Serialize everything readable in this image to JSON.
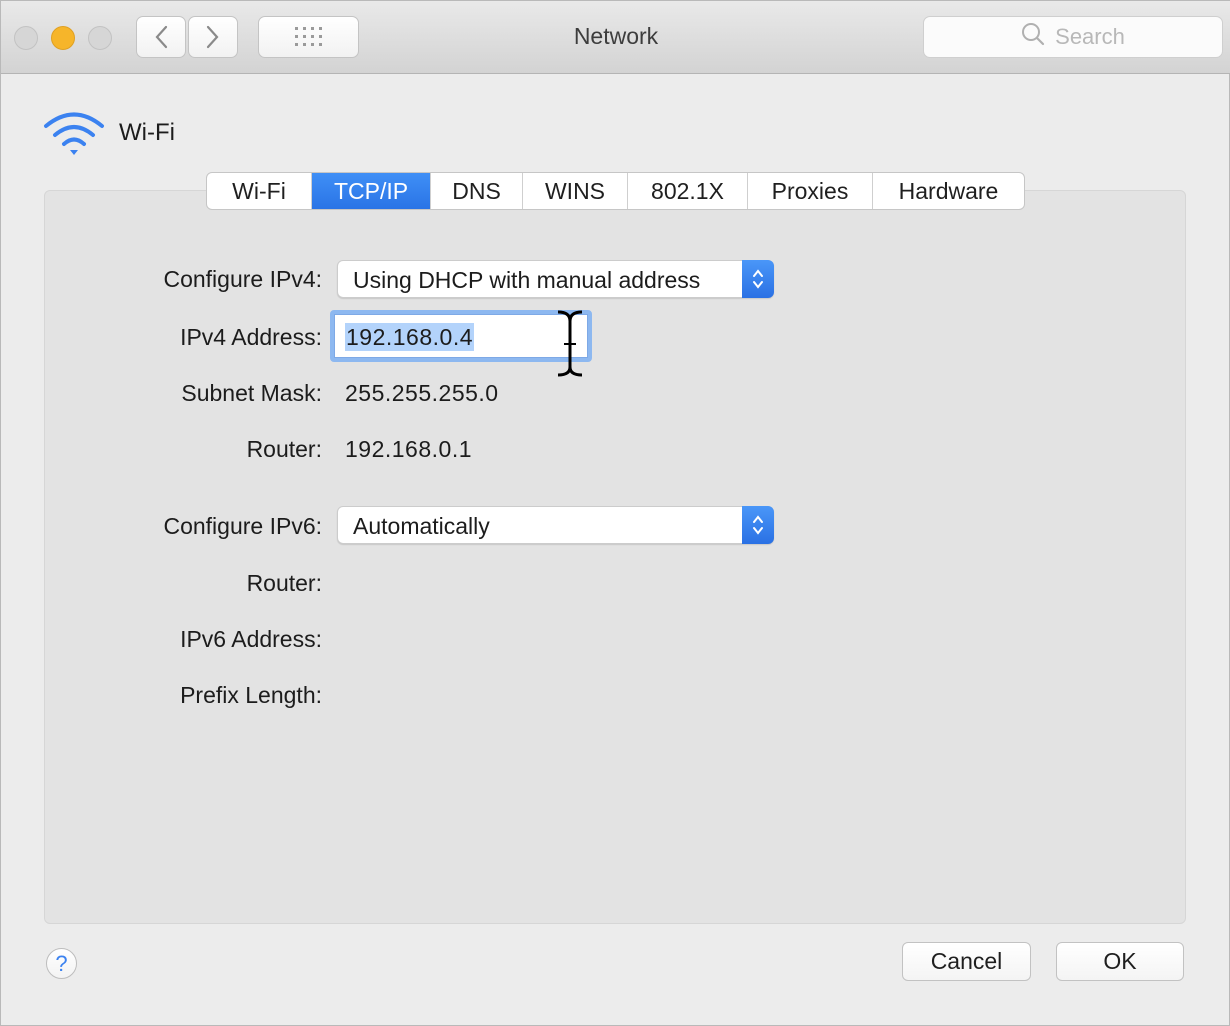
{
  "window": {
    "title": "Network",
    "search_placeholder": "Search",
    "controls": [
      "close",
      "minimize",
      "zoom"
    ],
    "nav_icons": [
      "chevron-left-icon",
      "chevron-right-icon",
      "grid-icon"
    ]
  },
  "interface": {
    "name": "Wi-Fi",
    "icon": "wifi-icon"
  },
  "tabs": [
    {
      "label": "Wi-Fi",
      "active": false
    },
    {
      "label": "TCP/IP",
      "active": true
    },
    {
      "label": "DNS",
      "active": false
    },
    {
      "label": "WINS",
      "active": false
    },
    {
      "label": "802.1X",
      "active": false
    },
    {
      "label": "Proxies",
      "active": false
    },
    {
      "label": "Hardware",
      "active": false
    }
  ],
  "ipv4": {
    "configure_label": "Configure IPv4:",
    "configure_value": "Using DHCP with manual address",
    "address_label": "IPv4 Address:",
    "address_value": "192.168.0.4",
    "subnet_label": "Subnet Mask:",
    "subnet_value": "255.255.255.0",
    "router_label": "Router:",
    "router_value": "192.168.0.1"
  },
  "ipv6": {
    "configure_label": "Configure IPv6:",
    "configure_value": "Automatically",
    "router_label": "Router:",
    "address_label": "IPv6 Address:",
    "prefix_label": "Prefix Length:"
  },
  "footer": {
    "help_label": "?",
    "cancel_label": "Cancel",
    "ok_label": "OK"
  },
  "colors": {
    "accent": "#2a74e6",
    "selection": "#b3d3fb",
    "minimize_light": "#f6b52a",
    "wifi_icon": "#3b82f0"
  }
}
